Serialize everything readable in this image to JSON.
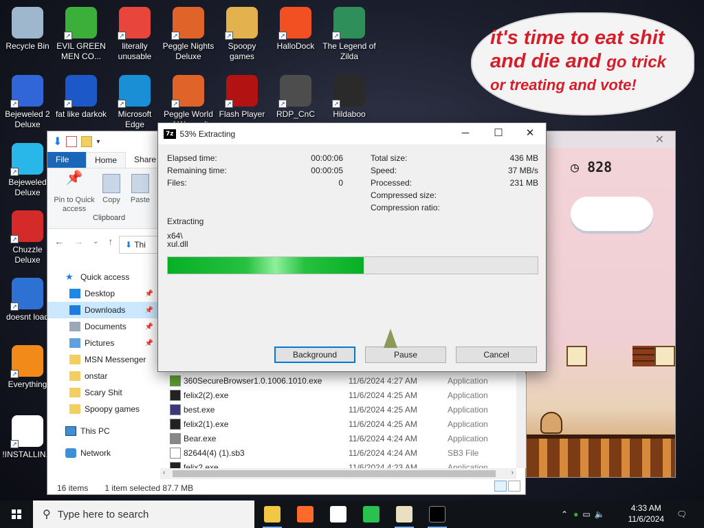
{
  "desktop": {
    "icons": [
      {
        "label": "Recycle Bin",
        "icon": "recycle-bin-icon",
        "color": "#9fb7cc"
      },
      {
        "label": "EVIL GREEN MEN CO...",
        "icon": "green-men-icon",
        "color": "#3cae3a"
      },
      {
        "label": "literally unusable",
        "icon": "chrome-icon",
        "color": "#e8453c"
      },
      {
        "label": "Peggle Nights Deluxe",
        "icon": "peggle-icon",
        "color": "#e0642a"
      },
      {
        "label": "Spoopy games",
        "icon": "folder-icon",
        "color": "#e3b24e"
      },
      {
        "label": "HalloDock",
        "icon": "windows-shield-icon",
        "color": "#f25022"
      },
      {
        "label": "The Legend of Zilda",
        "icon": "game-character-icon",
        "color": "#2f8f5a"
      },
      {
        "label": "Bejeweled 2 Deluxe",
        "icon": "bejeweled-icon",
        "color": "#3066d8"
      },
      {
        "label": "fat like darkok",
        "icon": "mpl-icon",
        "color": "#1c58c8"
      },
      {
        "label": "Microsoft Edge",
        "icon": "edge-icon",
        "color": "#1a8fd6"
      },
      {
        "label": "Peggle World of Warcraft",
        "icon": "peggle-icon",
        "color": "#e0642a"
      },
      {
        "label": "Flash Player",
        "icon": "flash-icon",
        "color": "#b31212"
      },
      {
        "label": "RDP_CnC",
        "icon": "rdp-icon",
        "color": "#4d4d4d"
      },
      {
        "label": "Hildaboo",
        "icon": "yashma-icon",
        "color": "#2a2a2a"
      },
      {
        "label": "Bejeweled Deluxe",
        "icon": "diamond-icon",
        "color": "#29b6e8"
      },
      {
        "label": "Chuzzle Deluxe",
        "icon": "chuzzle-icon",
        "color": "#d42a2a"
      },
      {
        "label": "doesnt load",
        "icon": "thunderbird-icon",
        "color": "#2d72d2"
      },
      {
        "label": "Everything",
        "icon": "search-icon",
        "color": "#f28a1a"
      },
      {
        "label": "!INSTALLIN...",
        "icon": "text-file-icon",
        "color": "#ffffff"
      }
    ]
  },
  "bubble": {
    "line1": "it's time to eat shit",
    "line2a": "and die and",
    "line2b": "go trick",
    "line3": "or treating and vote!"
  },
  "game": {
    "timer": "828"
  },
  "explorer": {
    "tabs": {
      "file": "File",
      "home": "Home",
      "share": "Share"
    },
    "ribbon": {
      "pin": "Pin to Quick access",
      "copy": "Copy",
      "paste": "Paste",
      "group": "Clipboard"
    },
    "address": "Thi",
    "nav": {
      "quick_access": "Quick access",
      "items": [
        {
          "label": "Desktop",
          "icon": "desktop-icon",
          "color": "#1e88e5",
          "pinned": true
        },
        {
          "label": "Downloads",
          "icon": "download-icon",
          "color": "#1e7be0",
          "pinned": true
        },
        {
          "label": "Documents",
          "icon": "documents-icon",
          "color": "#9ba8b8",
          "pinned": true
        },
        {
          "label": "Pictures",
          "icon": "pictures-icon",
          "color": "#5da1de",
          "pinned": true
        },
        {
          "label": "MSN Messenger",
          "icon": "folder-icon",
          "color": "#f3cf62",
          "pinned": false
        },
        {
          "label": "onstar",
          "icon": "folder-icon",
          "color": "#f3cf62",
          "pinned": false
        },
        {
          "label": "Scary Shit",
          "icon": "folder-icon",
          "color": "#f3cf62",
          "pinned": false
        },
        {
          "label": "Spoopy games",
          "icon": "folder-icon",
          "color": "#f3cf62",
          "pinned": false
        }
      ],
      "this_pc": "This PC",
      "network": "Network",
      "pin_glyph": "📌"
    },
    "files": [
      {
        "name": "360SecureBrowser1.0.1006.1010.exe",
        "date": "11/6/2024 4:27 AM",
        "type": "Application",
        "icon": "installer-icon",
        "color": "#5aa02c"
      },
      {
        "name": "felix2(2).exe",
        "date": "11/6/2024 4:25 AM",
        "type": "Application",
        "icon": "paw-icon",
        "color": "#222222"
      },
      {
        "name": "best.exe",
        "date": "11/6/2024 4:25 AM",
        "type": "Application",
        "icon": "app-icon",
        "color": "#3a3a7a"
      },
      {
        "name": "felix2(1).exe",
        "date": "11/6/2024 4:25 AM",
        "type": "Application",
        "icon": "paw-icon",
        "color": "#222222"
      },
      {
        "name": "Bear.exe",
        "date": "11/6/2024 4:24 AM",
        "type": "Application",
        "icon": "bear-icon",
        "color": "#888888"
      },
      {
        "name": "82644(4) (1).sb3",
        "date": "11/6/2024 4:24 AM",
        "type": "SB3 File",
        "icon": "file-icon",
        "color": "#ffffff"
      },
      {
        "name": "felix2.exe",
        "date": "11/6/2024 4:23 AM",
        "type": "Application",
        "icon": "paw-icon",
        "color": "#222222"
      }
    ],
    "status": {
      "count": "16 items",
      "selected": "1 item selected  87.7 MB"
    }
  },
  "dialog": {
    "title": "53% Extracting",
    "left": [
      {
        "label": "Elapsed time:",
        "value": "00:00:06"
      },
      {
        "label": "Remaining time:",
        "value": "00:00:05"
      },
      {
        "label": "Files:",
        "value": "0"
      }
    ],
    "right": [
      {
        "label": "Total size:",
        "value": "436 MB"
      },
      {
        "label": "Speed:",
        "value": "37 MB/s"
      },
      {
        "label": "Processed:",
        "value": "231 MB"
      },
      {
        "label": "Compressed size:",
        "value": ""
      },
      {
        "label": "Compression ratio:",
        "value": ""
      }
    ],
    "status_label": "Extracting",
    "path_dir": "x64\\",
    "path_file": "xul.dll",
    "progress": 0.53,
    "buttons": {
      "background": "Background",
      "pause": "Pause",
      "cancel": "Cancel"
    }
  },
  "taskbar": {
    "search_placeholder": "Type here to search",
    "apps": [
      {
        "icon": "file-explorer-icon",
        "color": "#f2c744",
        "running": true
      },
      {
        "icon": "firefox-icon",
        "color": "#ff6a2a",
        "running": false
      },
      {
        "icon": "paw-app-icon",
        "color": "#ffffff",
        "running": false
      },
      {
        "icon": "circle-e-icon",
        "color": "#2ac24f",
        "running": false
      },
      {
        "icon": "felix-icon",
        "color": "#e8e0c0",
        "running": true
      },
      {
        "icon": "7zip-icon",
        "color": "#000000",
        "running": true
      }
    ],
    "time": "4:33 AM",
    "date": "11/6/2024"
  }
}
